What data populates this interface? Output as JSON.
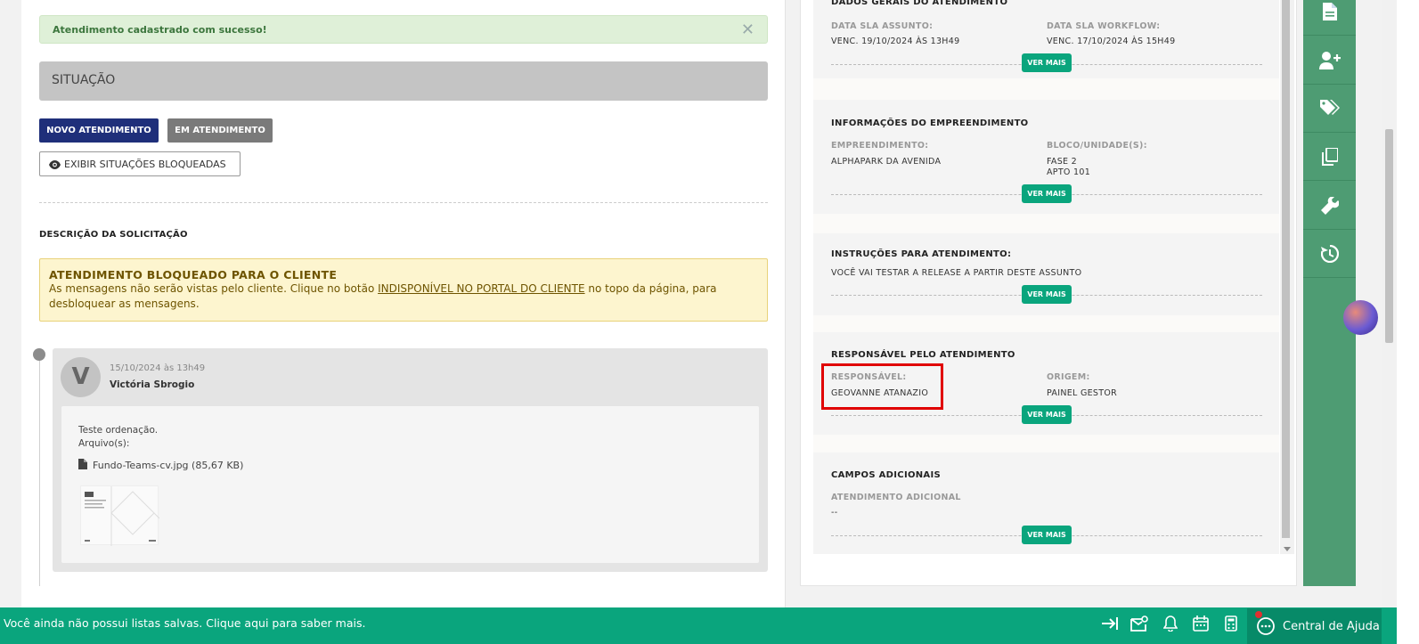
{
  "alerts": {
    "success": "Atendimento cadastrado com sucesso!",
    "close_glyph": "✕"
  },
  "situacao": {
    "title": "SITUAÇÃO",
    "btn_novo": "NOVO ATENDIMENTO",
    "btn_em": "EM ATENDIMENTO",
    "btn_exibir": "EXIBIR SITUAÇÕES BLOQUEADAS"
  },
  "descricao": {
    "title": "DESCRIÇÃO DA SOLICITAÇÃO",
    "warn_title": "ATENDIMENTO BLOQUEADO PARA O CLIENTE",
    "warn_text_1": "As mensagens não serão vistas pelo cliente. Clique no botão ",
    "warn_link": "INDISPONÍVEL NO PORTAL DO CLIENTE",
    "warn_text_2": " no topo da página, para",
    "warn_text_3": "desbloquear as mensagens."
  },
  "message": {
    "avatar_letter": "V",
    "date": "15/10/2024 às 13h49",
    "author": "Victória Sbrogio",
    "line1": "Teste ordenação.",
    "line2": "Arquivo(s):",
    "file": "Fundo-Teams-cv.jpg (85,67 KB)"
  },
  "sections": {
    "dados": {
      "title": "DADOS GERAIS DO ATENDIMENTO",
      "l1": "DATA SLA ASSUNTO:",
      "v1": "VENC. 19/10/2024 ÀS 13H49",
      "l2": "DATA SLA WORKFLOW:",
      "v2": "VENC. 17/10/2024 ÀS 15H49"
    },
    "empreendimento": {
      "title": "INFORMAÇÕES DO EMPREENDIMENTO",
      "l1": "EMPREENDIMENTO:",
      "v1": "ALPHAPARK DA AVENIDA",
      "l2": "BLOCO/UNIDADE(S):",
      "v2a": "FASE 2",
      "v2b": "APTO 101"
    },
    "instrucoes": {
      "title": "INSTRUÇÕES PARA ATENDIMENTO:",
      "v1": "VOCÊ VAI TESTAR A RELEASE A PARTIR DESTE ASSUNTO"
    },
    "responsavel": {
      "title": "RESPONSÁVEL PELO ATENDIMENTO",
      "l1": "RESPONSÁVEL:",
      "v1": "GEOVANNE ATANAZIO",
      "l2": "ORIGEM:",
      "v2": "PAINEL GESTOR"
    },
    "campos": {
      "title": "CAMPOS ADICIONAIS",
      "l1": "ATENDIMENTO ADICIONAL",
      "v1": "--"
    },
    "ver_mais": "VER MAIS"
  },
  "sidebar_icons": [
    "document-icon",
    "add-user-icon",
    "tag-icon",
    "copy-icon",
    "wrench-icon",
    "history-icon"
  ],
  "bottom": {
    "message": "Você ainda não possui listas salvas. Clique aqui para saber mais.",
    "help": "Central de Ajuda"
  },
  "colors": {
    "accent_green": "#0aa57d",
    "sidebar_green": "#4e9c73",
    "primary_blue": "#1f2f7a",
    "highlight_red": "#e00000"
  }
}
